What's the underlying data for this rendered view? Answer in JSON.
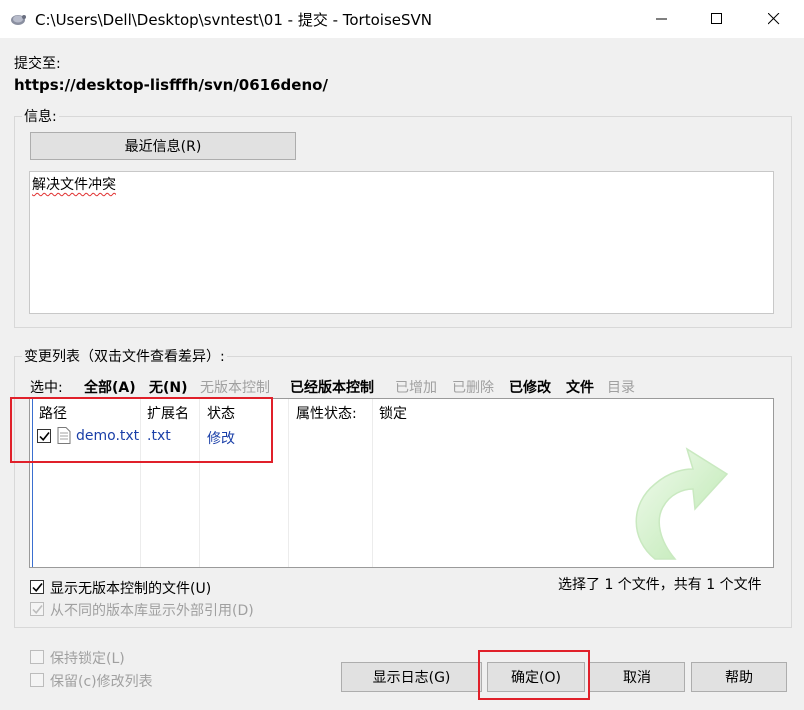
{
  "window": {
    "title": "C:\\Users\\Dell\\Desktop\\svntest\\01 - 提交 - TortoiseSVN"
  },
  "commit_to_label": "提交至:",
  "commit_url": "https://desktop-lisfffh/svn/0616deno/",
  "message_group": {
    "label": "信息:",
    "recent_button": "最近信息(R)",
    "message_text": "解决文件冲突"
  },
  "changes_group": {
    "label": "变更列表（双击文件查看差异）:",
    "select_label": "选中:",
    "filters": [
      {
        "label": "全部(A)",
        "enabled": true
      },
      {
        "label": "无(N)",
        "enabled": true
      },
      {
        "label": "无版本控制",
        "enabled": false
      },
      {
        "label": "已经版本控制",
        "enabled": true
      },
      {
        "label": "已增加",
        "enabled": false
      },
      {
        "label": "已删除",
        "enabled": false
      },
      {
        "label": "已修改",
        "enabled": true
      },
      {
        "label": "文件",
        "enabled": true
      },
      {
        "label": "目录",
        "enabled": false
      }
    ],
    "columns": [
      "路径",
      "扩展名",
      "状态",
      "属性状态:",
      "锁定"
    ],
    "rows": [
      {
        "checked": true,
        "path": "demo.txt",
        "ext": ".txt",
        "status": "修改",
        "prop_status": "",
        "lock": ""
      }
    ],
    "show_unversioned": "显示无版本控制的文件(U)",
    "show_externals": "从不同的版本库显示外部引用(D)",
    "summary": "选择了 1 个文件，共有 1 个文件"
  },
  "options": {
    "keep_locks": "保持锁定(L)",
    "keep_changelists": "保留(c)修改列表"
  },
  "buttons": {
    "show_log": "显示日志(G)",
    "ok": "确定(O)",
    "cancel": "取消",
    "help": "帮助"
  },
  "colors": {
    "highlight": "#e0202a",
    "link_blue": "#1a3fa8"
  }
}
